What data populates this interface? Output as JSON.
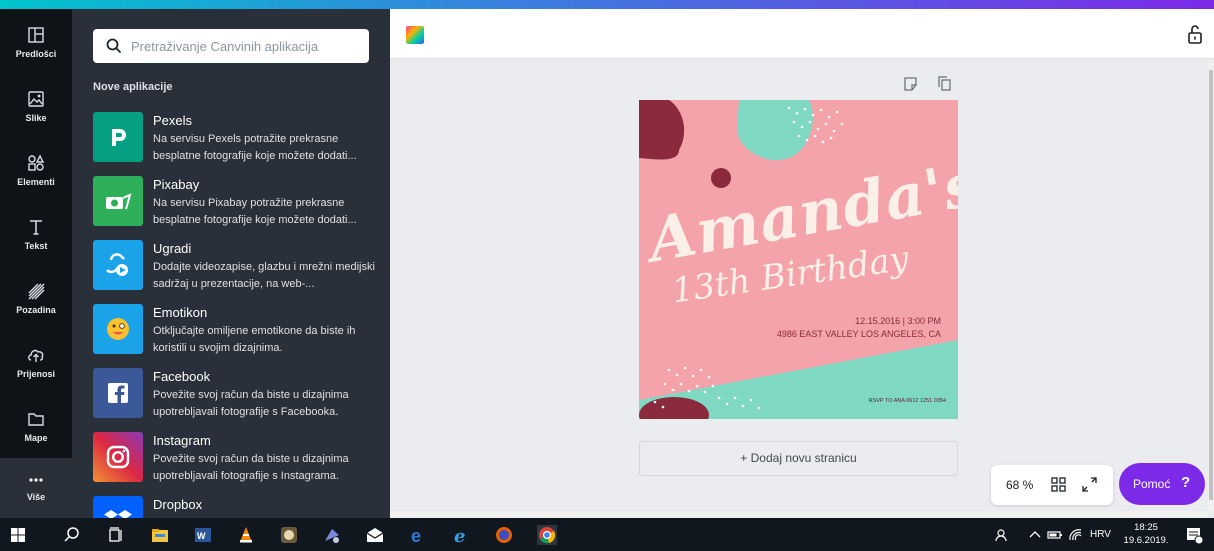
{
  "left_nav": {
    "items": [
      {
        "label": "Predlošci",
        "icon": "template-icon"
      },
      {
        "label": "Slike",
        "icon": "image-icon"
      },
      {
        "label": "Elementi",
        "icon": "shapes-icon"
      },
      {
        "label": "Tekst",
        "icon": "text-icon"
      },
      {
        "label": "Pozadina",
        "icon": "background-icon"
      },
      {
        "label": "Prijenosi",
        "icon": "upload-icon"
      },
      {
        "label": "Mape",
        "icon": "folder-icon"
      },
      {
        "label": "Više",
        "icon": "more-icon"
      }
    ]
  },
  "panel": {
    "search_placeholder": "Pretraživanje Canvinih aplikacija",
    "section_title": "Nove aplikacije",
    "apps": [
      {
        "name": "Pexels",
        "desc": "Na servisu Pexels potražite prekrasne besplatne fotografije koje možete dodati...",
        "color": "#05a081"
      },
      {
        "name": "Pixabay",
        "desc": "Na servisu Pixabay potražite prekrasne besplatne fotografije koje možete dodati...",
        "color": "#2eb05a"
      },
      {
        "name": "Ugradi",
        "desc": "Dodajte videozapise, glazbu i mrežni medijski sadržaj u prezentacije, na web-...",
        "color": "#1aa3e8"
      },
      {
        "name": "Emotikon",
        "desc": "Otključajte omiljene emotikone da biste ih koristili u svojim dizajnima.",
        "color": "#1aa3e8"
      },
      {
        "name": "Facebook",
        "desc": "Povežite svoj račun da biste u dizajnima upotrebljavali fotografije s Facebooka.",
        "color": "#3b5998"
      },
      {
        "name": "Instagram",
        "desc": "Povežite svoj račun da biste u dizajnima upotrebljavali fotografije s Instagrama.",
        "color": "#c1357d"
      },
      {
        "name": "Dropbox",
        "desc": "",
        "color": "#0061fe"
      }
    ]
  },
  "design": {
    "title": "Amanda's",
    "subtitle": "13th Birthday",
    "date_line": "12.15.2016 | 3:00 PM",
    "address_line": "4986 EAST VALLEY LOS ANGELES, CA",
    "rsvp_line": "RSVP TO ANA 0612 1251 0354",
    "colors": {
      "background": "#f4a3aa",
      "mint": "#7fd8c2",
      "maroon": "#8a2a3c",
      "cream": "#fbf0e8"
    }
  },
  "editor": {
    "add_page_label": "+ Dodaj novu stranicu",
    "zoom_level": "68 %",
    "help_label": "Pomoć",
    "help_q": "?"
  },
  "taskbar": {
    "language": "HRV",
    "time": "18:25",
    "date": "19.6.2019."
  }
}
